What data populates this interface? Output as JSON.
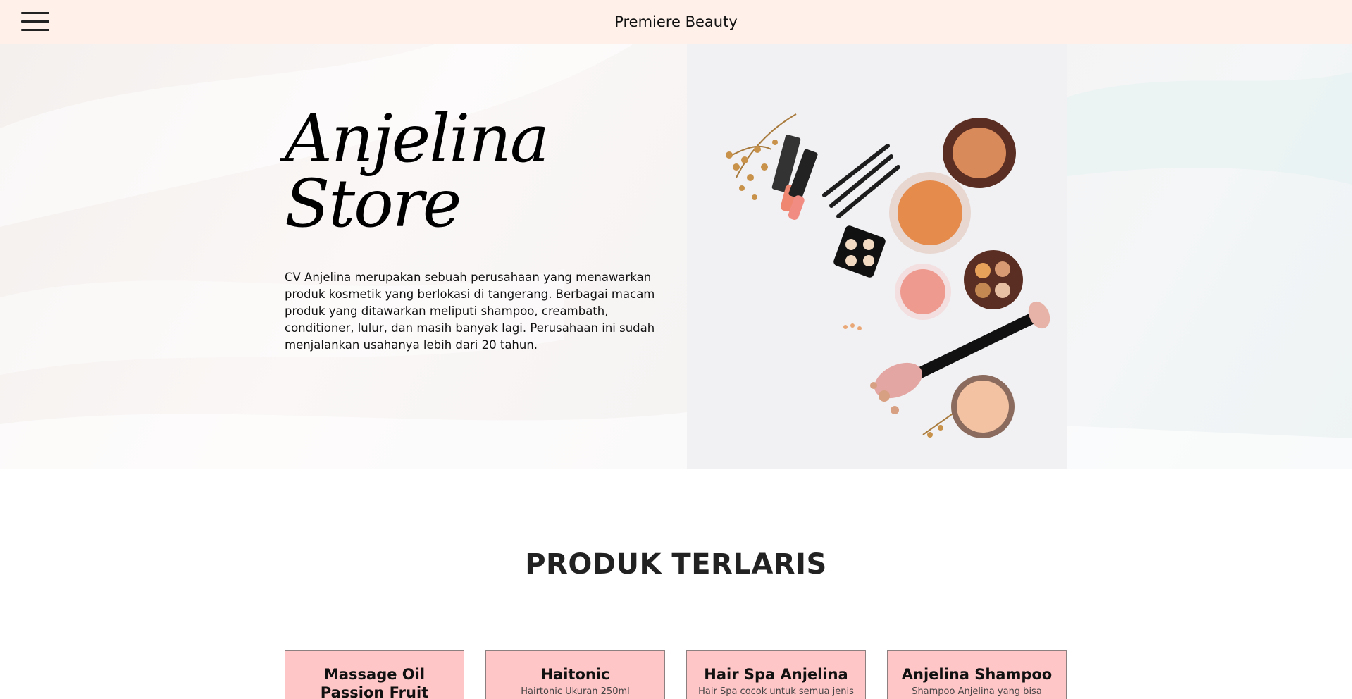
{
  "header": {
    "brand": "Premiere Beauty",
    "menu_icon": "hamburger-menu-icon"
  },
  "hero": {
    "title_line1": "Anjelina",
    "title_line2": "Store",
    "description": "CV Anjelina merupakan sebuah perusahaan yang menawarkan produk kosmetik yang berlokasi di tangerang. Berbagai macam produk yang ditawarkan meliputi shampoo, creambath, conditioner, lulur, dan masih banyak lagi. Perusahaan ini sudah menjalankan usahanya lebih dari 20 tahun."
  },
  "products": {
    "section_title": "PRODUK TERLARIS",
    "items": [
      {
        "name": "Massage Oil Passion Fruit",
        "desc": ""
      },
      {
        "name": "Haitonic",
        "desc": "Hairtonic Ukuran 250ml"
      },
      {
        "name": "Hair Spa Anjelina",
        "desc": "Hair Spa cocok untuk semua jenis"
      },
      {
        "name": "Anjelina Shampoo",
        "desc": "Shampoo Anjelina yang bisa"
      }
    ]
  },
  "colors": {
    "topbar": "#fff1ea",
    "card": "#ffc6c8",
    "title": "#222222"
  }
}
